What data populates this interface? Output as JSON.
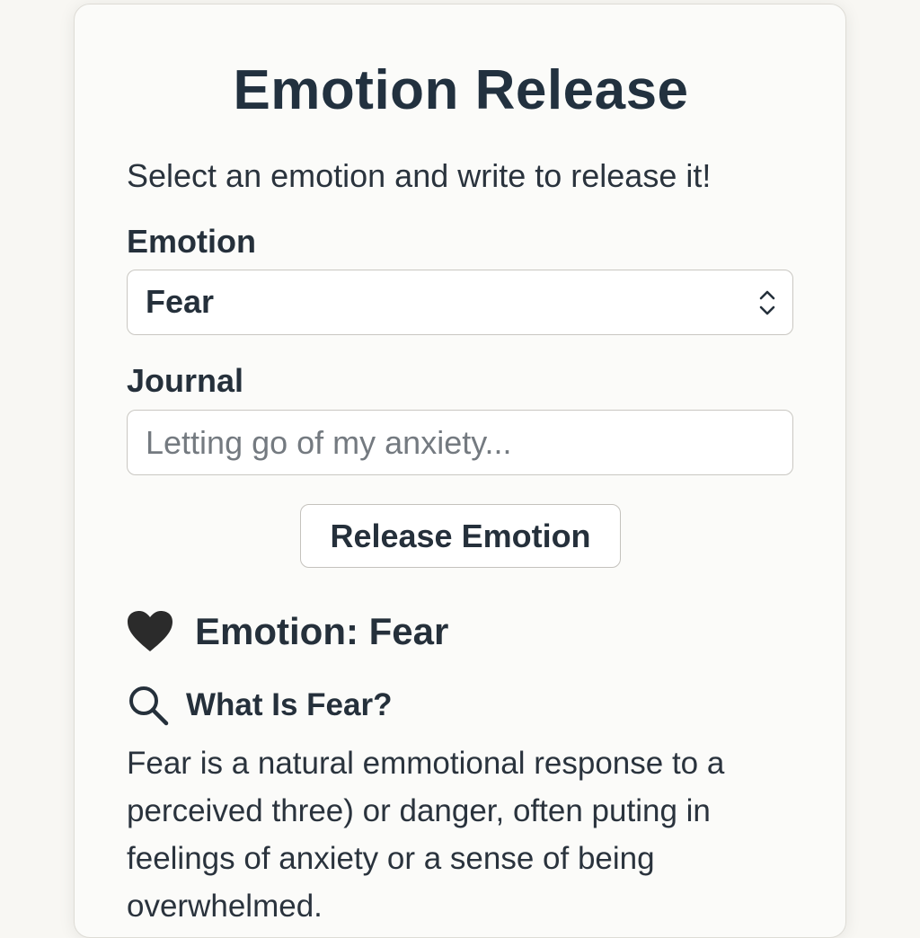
{
  "app": {
    "title": "Emotion Release",
    "subtitle": "Select an emotion and write to release it!"
  },
  "form": {
    "emotion_label": "Emotion",
    "emotion_selected": "Fear",
    "journal_label": "Journal",
    "journal_placeholder": "Letting go of my anxiety...",
    "journal_value": "",
    "release_button_label": "Release Emotion"
  },
  "result": {
    "heading": "Emotion: Fear",
    "heading_icon": "heart-icon",
    "info_heading": "What Is Fear?",
    "info_icon": "search-icon",
    "description": "Fear is a natural emmotional response to a perceived three) or danger, often puting in feelings of anxiety or a sense of being overwhelmed."
  },
  "colors": {
    "page_background": "#f8f7f3",
    "card_background": "#fbfbf9",
    "text_primary": "#25303b",
    "border": "#c9c7c2",
    "heart": "#2b2b2b"
  }
}
